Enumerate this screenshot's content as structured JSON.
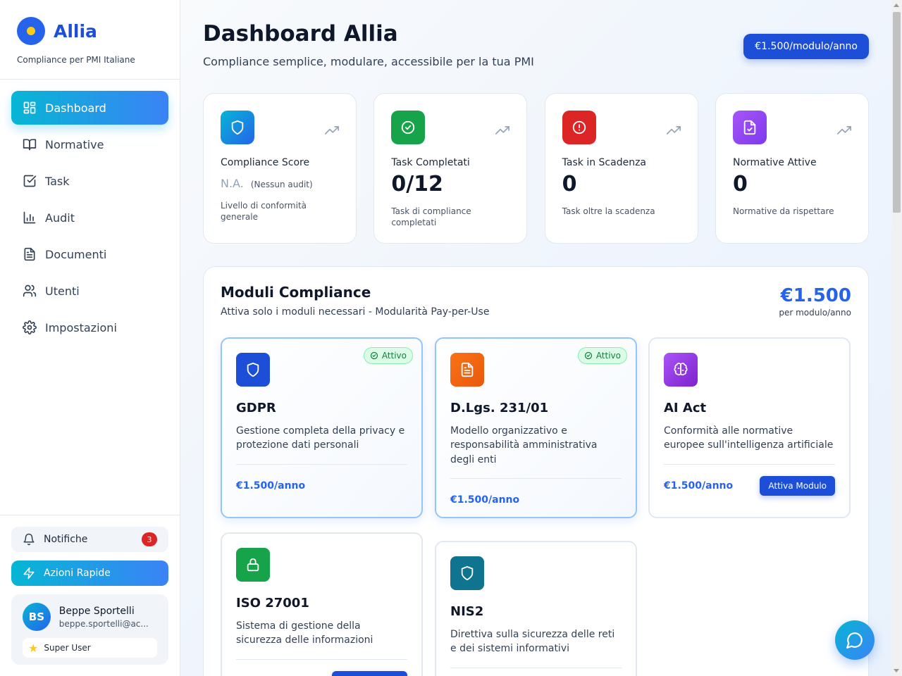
{
  "brand": {
    "name": "Allia",
    "subtitle": "Compliance per PMI Italiane"
  },
  "sidebar": {
    "items": [
      {
        "label": "Dashboard",
        "icon": "grid-icon",
        "active": true
      },
      {
        "label": "Normative",
        "icon": "book-icon"
      },
      {
        "label": "Task",
        "icon": "checkbox-icon"
      },
      {
        "label": "Audit",
        "icon": "bar-chart-icon"
      },
      {
        "label": "Documenti",
        "icon": "document-icon"
      },
      {
        "label": "Utenti",
        "icon": "users-icon"
      },
      {
        "label": "Impostazioni",
        "icon": "gear-icon"
      }
    ],
    "notifications": {
      "label": "Notifiche",
      "count": "3"
    },
    "quick_actions": {
      "label": "Azioni Rapide"
    },
    "user": {
      "initials": "BS",
      "name": "Beppe Sportelli",
      "email": "beppe.sportelli@ac...",
      "role": "Super User"
    }
  },
  "header": {
    "title": "Dashboard Allia",
    "subtitle": "Compliance semplice, modulare, accessibile per la tua PMI",
    "price_button": "€1.500/modulo/anno"
  },
  "stats": [
    {
      "label": "Compliance Score",
      "value": "N.A.",
      "note": "(Nessun audit)",
      "desc": "Livello di conformità generale",
      "color": "#2563eb"
    },
    {
      "label": "Task Completati",
      "value": "0/12",
      "desc": "Task di compliance completati",
      "color": "#16a34a"
    },
    {
      "label": "Task in Scadenza",
      "value": "0",
      "desc": "Task oltre la scadenza",
      "color": "#dc2626"
    },
    {
      "label": "Normative Attive",
      "value": "0",
      "desc": "Normative da rispettare",
      "color": "#9333ea"
    }
  ],
  "modules": {
    "title": "Moduli Compliance",
    "subtitle": "Attiva solo i moduli necessari - Modularità Pay-per-Use",
    "price": "€1.500",
    "price_unit": "per modulo/anno",
    "active_label": "Attivo",
    "activate_label": "Attiva Modulo",
    "cards": [
      {
        "name": "GDPR",
        "desc": "Gestione completa della privacy e protezione dati personali",
        "cost": "€1.500/anno",
        "active": true,
        "color": "#1d4ed8",
        "icon": "shield-icon"
      },
      {
        "name": "D.Lgs. 231/01",
        "desc": "Modello organizzativo e responsabilità amministrativa degli enti",
        "cost": "€1.500/anno",
        "active": true,
        "color": "#ea580c",
        "icon": "document-icon"
      },
      {
        "name": "AI Act",
        "desc": "Conformità alle normative europee sull'intelligenza artificiale",
        "cost": "€1.500/anno",
        "active": false,
        "color": "#9333ea",
        "icon": "brain-icon"
      },
      {
        "name": "ISO 27001",
        "desc": "Sistema di gestione della sicurezza delle informazioni",
        "active": false,
        "color": "#16a34a",
        "icon": "lock-icon"
      },
      {
        "name": "NIS2",
        "desc": "Direttiva sulla sicurezza delle reti e dei sistemi informativi",
        "active": false,
        "color": "#0e7490",
        "icon": "shield-icon"
      }
    ]
  }
}
